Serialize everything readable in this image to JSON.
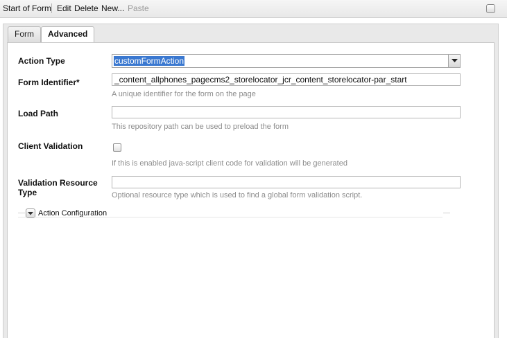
{
  "toolbar": {
    "title": "Start of Form",
    "edit_label": "Edit",
    "delete_label": "Delete",
    "new_label": "New...",
    "paste_label": "Paste"
  },
  "tabs": [
    {
      "label": "Form",
      "active": false
    },
    {
      "label": "Advanced",
      "active": true
    }
  ],
  "fields": {
    "action_type": {
      "label": "Action Type",
      "value": "customFormAction"
    },
    "form_identifier": {
      "label": "Form Identifier*",
      "value": "_content_allphones_pagecms2_storelocator_jcr_content_storelocator-par_start",
      "hint": "A unique identifier for the form on the page"
    },
    "load_path": {
      "label": "Load Path",
      "value": "",
      "hint": "This repository path can be used to preload the form"
    },
    "client_validation": {
      "label": "Client Validation",
      "checked": false,
      "hint": "If this is enabled java-script client code for validation will be generated"
    },
    "validation_resource_type": {
      "label_line1": "Validation Resource",
      "label_line2": "Type",
      "value": "",
      "hint": "Optional resource type which is used to find a global form validation script."
    }
  },
  "action_configuration": {
    "label": "Action Configuration",
    "collapsed": true
  },
  "colors": {
    "selection": "#3a78d0",
    "hint_text": "#8c8c8c"
  }
}
